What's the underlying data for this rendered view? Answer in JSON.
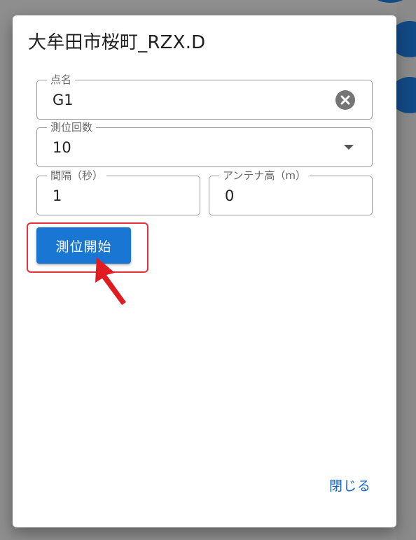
{
  "dialog": {
    "title": "大牟田市桜町_RZX.D",
    "close_label": "閉じる"
  },
  "form": {
    "point_name": {
      "label": "点名",
      "value": "G1"
    },
    "measure_count": {
      "label": "測位回数",
      "value": "10"
    },
    "interval": {
      "label": "間隔（秒）",
      "value": "1"
    },
    "antenna_height": {
      "label": "アンテナ高（m）",
      "value": "0"
    }
  },
  "actions": {
    "start_label": "測位開始"
  },
  "icons": {
    "clear": "clear-circle-icon",
    "dropdown": "caret-down-icon",
    "pointer": "red-arrow-icon"
  },
  "colors": {
    "primary": "#1976d2",
    "highlight": "#e8303a",
    "link": "#1565c0"
  }
}
